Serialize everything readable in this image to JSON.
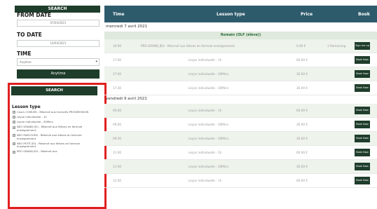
{
  "sidebar": {
    "search_header": "SEARCH",
    "from_date_label": "FROM DATE",
    "from_date_value": "07/04/2021",
    "to_date_label": "TO DATE",
    "to_date_value": "14/04/2021",
    "time_label": "TIME",
    "time_value": "Anytime",
    "anytime_button": "Anytime",
    "search_button": "SEARCH",
    "lesson_type_title": "Lesson type",
    "lesson_types": [
      "Cours COMUSS - Réservé aux licenciés PROGRESSION",
      "Leçon individuelle - 1h",
      "Leçon individuelle - 30Mins",
      "NEO GRAND JEU - Réservé aux élèves en formule enseignement",
      "NEO PARCOURS - Réservé aux élèves en formule enseignement",
      "NEO PETIT JEU - Réservé aux élèves en formule enseignement",
      "PRO GRAND JEU - Réservé aux"
    ]
  },
  "table": {
    "headers": {
      "time": "Time",
      "lesson_type": "Lesson type",
      "price": "Price",
      "book": "Book"
    },
    "days": [
      {
        "label": "mercredi 7 avril 2021",
        "session": "Romain (OLF (élève))",
        "rows": [
          {
            "time": "16:00",
            "lesson": "PRO GRAND JEU - Réservé aux élèves en formule enseignement",
            "price": "0.00 €",
            "extra": "1 Remaining",
            "action": "Sign me up"
          },
          {
            "time": "17:00",
            "lesson": "Leçon individuelle - 1h",
            "price": "60.00 €",
            "extra": "",
            "action": "Book Now"
          },
          {
            "time": "17:00",
            "lesson": "Leçon individuelle - 30Mins",
            "price": "30.00 €",
            "extra": "",
            "action": "Book Now"
          },
          {
            "time": "17:30",
            "lesson": "Leçon individuelle - 30Mins",
            "price": "30.00 €",
            "extra": "",
            "action": "Book Now"
          }
        ]
      },
      {
        "label": "vendredi 9 avril 2021",
        "session": "",
        "rows": [
          {
            "time": "09:00",
            "lesson": "Leçon individuelle - 1h",
            "price": "60.00 €",
            "extra": "",
            "action": "Book Now"
          },
          {
            "time": "09:00",
            "lesson": "Leçon individuelle - 30Mins",
            "price": "30.00 €",
            "extra": "",
            "action": "Book Now"
          },
          {
            "time": "09:30",
            "lesson": "Leçon individuelle - 30Mins",
            "price": "30.00 €",
            "extra": "",
            "action": "Book Now"
          },
          {
            "time": "11:00",
            "lesson": "Leçon individuelle - 1h",
            "price": "60.00 €",
            "extra": "",
            "action": "Book Now"
          },
          {
            "time": "11:00",
            "lesson": "Leçon individuelle - 30Mins",
            "price": "30.00 €",
            "extra": "",
            "action": "Book Now"
          },
          {
            "time": "12:00",
            "lesson": "Leçon individuelle - 1h",
            "price": "60.00 €",
            "extra": "",
            "action": "Book Now"
          }
        ]
      }
    ]
  },
  "colors": {
    "sidebar_dark": "#1f3d2b",
    "table_header": "#2e5b6c",
    "highlight_border": "#e02020",
    "row_shade": "#eef3ec"
  }
}
